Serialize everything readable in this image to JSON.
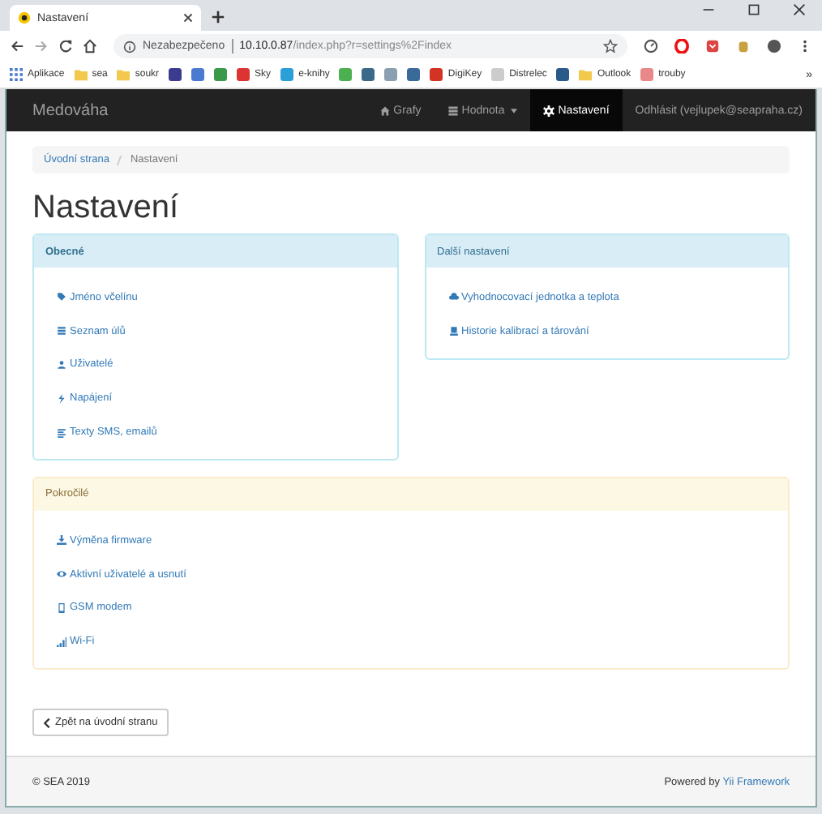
{
  "browser": {
    "tab_title": "Nastavení",
    "security": "Nezabezpečeno",
    "url_host": "10.10.0.87",
    "url_path": "/index.php?r=settings%2Findex",
    "more_bookmarks": "»",
    "bookmarks": [
      {
        "kind": "apps",
        "label": "Aplikace",
        "color": "#4a7bd0"
      },
      {
        "kind": "folder",
        "label": "sea",
        "color": "#f2c94c"
      },
      {
        "kind": "folder",
        "label": "soukr",
        "color": "#f2c94c"
      },
      {
        "kind": "site",
        "color": "#3b3b8f"
      },
      {
        "kind": "site",
        "color": "#4a7bd0"
      },
      {
        "kind": "site",
        "color": "#3a9a4a"
      },
      {
        "kind": "site",
        "label": "Sky",
        "color": "#dd3333"
      },
      {
        "kind": "site",
        "label": "e-knihy",
        "color": "#2a9fd8"
      },
      {
        "kind": "site",
        "color": "#4caf50"
      },
      {
        "kind": "site",
        "color": "#3a6a8a"
      },
      {
        "kind": "site",
        "color": "#8aa0b0"
      },
      {
        "kind": "site",
        "color": "#3a6a9a"
      },
      {
        "kind": "site",
        "label": "DigiKey",
        "color": "#d33322"
      },
      {
        "kind": "site",
        "label": "Distrelec",
        "color": "#cccccc"
      },
      {
        "kind": "site",
        "color": "#2a5a8a"
      },
      {
        "kind": "folder",
        "label": "Outlook",
        "color": "#f2c94c"
      },
      {
        "kind": "site",
        "label": "trouby",
        "color": "#e88888"
      }
    ]
  },
  "navbar": {
    "brand": "Medováha",
    "items": [
      {
        "kind": "home",
        "label": "Grafy",
        "selected": false
      },
      {
        "kind": "list",
        "label": "Hodnota",
        "selected": false,
        "dropdown": true
      },
      {
        "kind": "gear",
        "label": "Nastavení",
        "selected": true
      },
      {
        "kind": "none",
        "label": "Odhlásit (vejlupek@seapraha.cz)",
        "selected": false
      }
    ]
  },
  "breadcrumb": [
    "Úvodní strana",
    "Nastavení"
  ],
  "heading": "Nastavení",
  "panels": [
    {
      "title": "Obecné",
      "kind": "info",
      "items": [
        {
          "kind": "tag",
          "label": "Jméno včelínu"
        },
        {
          "kind": "list",
          "label": "Seznam úlů"
        },
        {
          "kind": "user",
          "label": "Uživatelé"
        },
        {
          "kind": "bolt",
          "label": "Napájení"
        },
        {
          "kind": "text",
          "label": "Texty SMS, emailů"
        }
      ]
    },
    {
      "title": "Další nastavení",
      "kind": "info",
      "items": [
        {
          "kind": "cloud",
          "label": "Vyhodnocovací jednotka a teplota"
        },
        {
          "kind": "book",
          "label": "Historie kalibrací a tárování"
        }
      ]
    },
    {
      "title": "Pokročilé",
      "kind": "warning",
      "items": [
        {
          "kind": "download",
          "label": "Výměna firmware"
        },
        {
          "kind": "eye",
          "label": "Aktivní uživatelé a usnutí"
        },
        {
          "kind": "phone",
          "label": "GSM modem"
        },
        {
          "kind": "signal",
          "label": "Wi-Fi"
        }
      ]
    }
  ],
  "back_button": "Zpět na úvodní stranu",
  "footer": {
    "copyright": "© SEA 2019",
    "powered": "Powered by",
    "link": "Yii Framework"
  }
}
